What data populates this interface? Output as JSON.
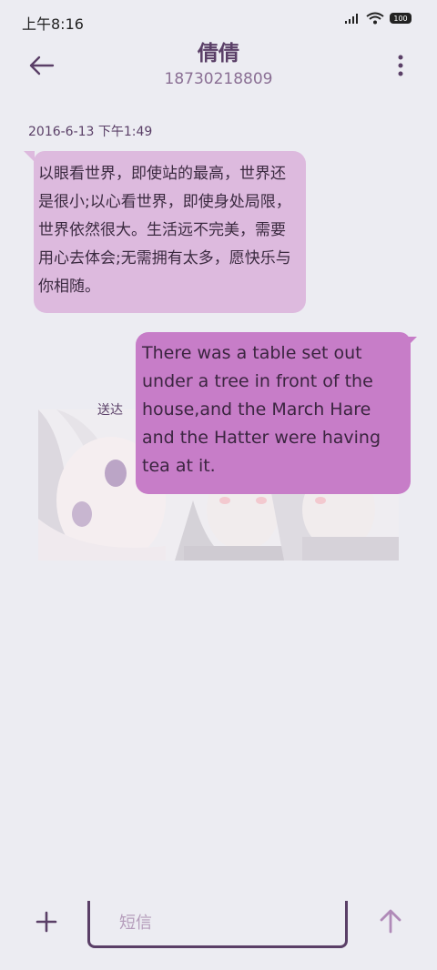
{
  "status_bar": {
    "time": "上午8:16",
    "battery": "100"
  },
  "header": {
    "contact_name": "倩倩",
    "contact_number": "18730218809"
  },
  "conversation": {
    "timestamp": "2016-6-13 下午1:49",
    "incoming_message": "以眼看世界，即使站的最高，世界还是很小;以心看世界，即使身处局限，世界依然很大。生活远不完美，需要用心去体会;无需拥有太多，愿快乐与你相随。",
    "outgoing_message": "There was a table set out under a tree in front of the house,and the March Hare and the Hatter were having tea at it.",
    "delivered_status": "送达"
  },
  "composer": {
    "placeholder": "短信"
  },
  "colors": {
    "background": "#ECECF2",
    "incoming_bubble": "#DDBADE",
    "outgoing_bubble": "#C77DC8",
    "accent": "#5a3f67"
  },
  "icons": {
    "back": "back-arrow-icon",
    "more": "more-vertical-icon",
    "add": "plus-icon",
    "send": "arrow-up-icon",
    "signal": "signal-icon",
    "wifi": "wifi-icon",
    "battery": "battery-icon"
  }
}
